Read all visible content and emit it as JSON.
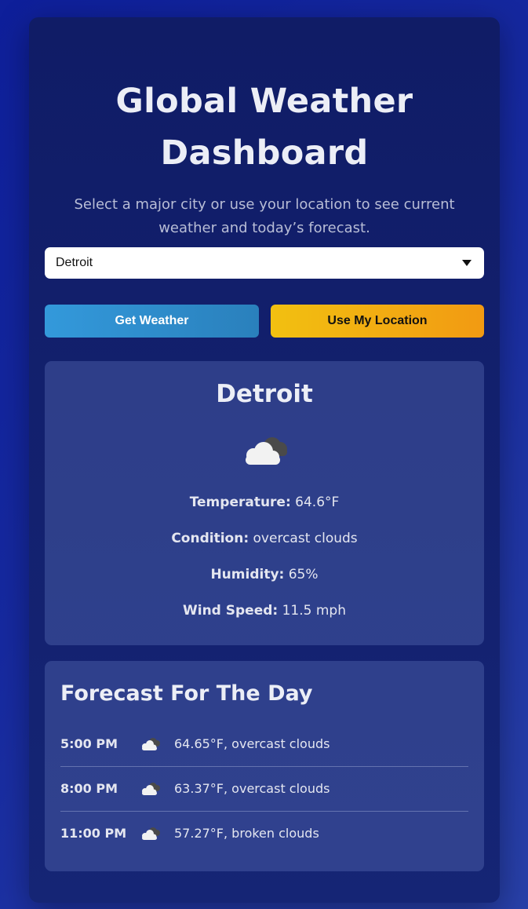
{
  "header": {
    "title_line1": "Global Weather",
    "title_line2": "Dashboard",
    "subtitle_line1": "Select a major city or use your location to see current",
    "subtitle_line2": "weather and today’s forecast."
  },
  "city_select": {
    "selected": "Detroit"
  },
  "buttons": {
    "get_weather": "Get Weather",
    "use_location": "Use My Location"
  },
  "current": {
    "city": "Detroit",
    "icon": "overcast-cloud-icon",
    "temperature_label": "Temperature:",
    "temperature_value": "64.6°F",
    "condition_label": "Condition:",
    "condition_value": "overcast clouds",
    "humidity_label": "Humidity:",
    "humidity_value": "65%",
    "wind_label": "Wind Speed:",
    "wind_value": "11.5 mph"
  },
  "forecast": {
    "title": "Forecast For The Day",
    "items": [
      {
        "time": "5:00 PM",
        "icon": "overcast-cloud-icon",
        "text": "64.65°F, overcast clouds"
      },
      {
        "time": "8:00 PM",
        "icon": "overcast-cloud-icon",
        "text": "63.37°F, overcast clouds"
      },
      {
        "time": "11:00 PM",
        "icon": "broken-cloud-icon",
        "text": "57.27°F, broken clouds"
      }
    ]
  },
  "colors": {
    "primary_button": "#3399db",
    "secondary_button": "#f2c011",
    "card_background": "#101c66"
  }
}
